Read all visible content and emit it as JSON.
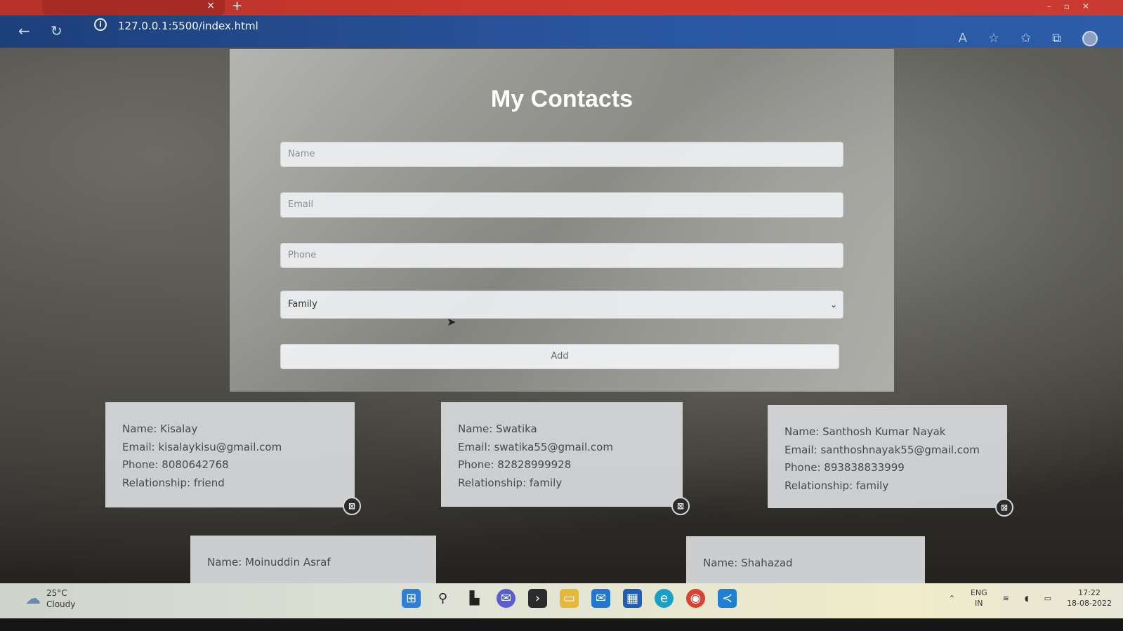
{
  "browser": {
    "tab_close": "×",
    "new_tab": "+",
    "url": "127.0.0.1:5500/index.html"
  },
  "form": {
    "title": "My Contacts",
    "name_placeholder": "Name",
    "email_placeholder": "Email",
    "phone_placeholder": "Phone",
    "relationship_selected": "Family",
    "add_label": "Add"
  },
  "contacts": [
    {
      "name": "Name: Kisalay",
      "email": "Email: kisalaykisu@gmail.com",
      "phone": "Phone: 8080642768",
      "relationship": "Relationship: friend"
    },
    {
      "name": "Name: Swatika",
      "email": "Email: swatika55@gmail.com",
      "phone": "Phone: 82828999928",
      "relationship": "Relationship: family"
    },
    {
      "name": "Name: Santhosh Kumar Nayak",
      "email": "Email: santhoshnayak55@gmail.com",
      "phone": "Phone: 893838833999",
      "relationship": "Relationship: family"
    },
    {
      "name": "Name: Moinuddin Asraf"
    },
    {
      "name": "Name: Shahazad"
    }
  ],
  "taskbar": {
    "temperature": "25°C",
    "weather": "Cloudy",
    "lang_top": "ENG",
    "lang_bottom": "IN",
    "time": "17:22",
    "date": "18-08-2022"
  },
  "icons": {
    "delete": "trash-x-icon",
    "start": "windows-start-icon"
  }
}
